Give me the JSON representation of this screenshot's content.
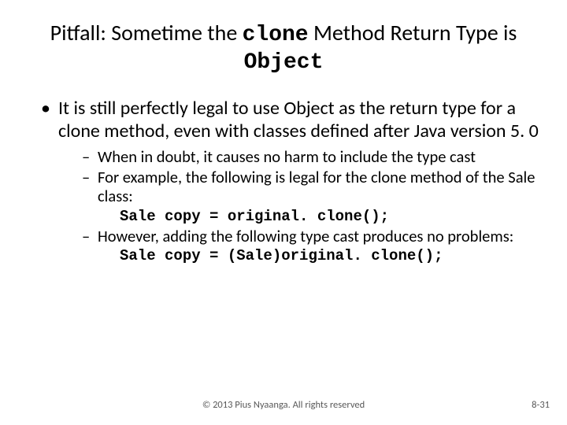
{
  "title": {
    "prefix": "Pitfall:  Sometime the ",
    "code1": "clone",
    "mid": " Method Return Type is ",
    "code2": "Object"
  },
  "bullet_main": "It is still perfectly legal to use Object as the return type for a clone method, even with classes defined after Java version 5. 0",
  "sub1": "When in doubt, it causes no harm to include the type cast",
  "sub2": "For example, the following is legal for the clone method of the Sale class:",
  "code_a": "Sale copy = original. clone();",
  "sub3": "However, adding the following type cast produces no problems:",
  "code_b": "Sale copy = (Sale)original. clone();",
  "copyright": "© 2013 Pius Nyaanga. All rights reserved",
  "page": "8-31"
}
